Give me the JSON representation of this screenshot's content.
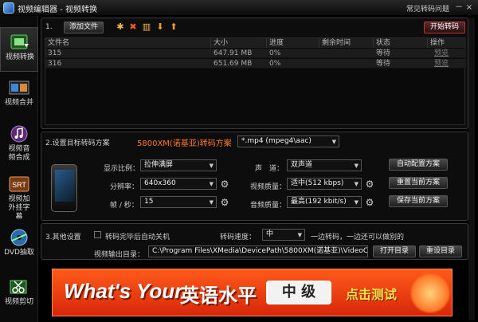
{
  "window": {
    "title": "视频编辑器 - 视频转换",
    "help_link": "常见转码问题",
    "minimize": "－",
    "close": "×"
  },
  "sidebar": {
    "items": [
      {
        "label": "视频转换",
        "icon": "film-convert-icon"
      },
      {
        "label": "视频合并",
        "icon": "film-merge-icon"
      },
      {
        "label": "视频音频合成",
        "icon": "music-note-icon"
      },
      {
        "label": "视频加外挂字幕",
        "icon": "subtitle-icon"
      },
      {
        "label": "DVD抽取",
        "icon": "dvd-disc-icon"
      },
      {
        "label": "视频剪切",
        "icon": "scissors-icon"
      }
    ]
  },
  "files": {
    "section_num": "1.",
    "add_button": "添加文件",
    "start_button": "开始转码",
    "toolbar_icons": [
      "settings-icon",
      "delete-icon",
      "trash-icon",
      "move-down-icon",
      "move-up-icon"
    ],
    "columns": [
      "文件名",
      "大小",
      "进度",
      "剩余时间",
      "状态",
      "操作"
    ],
    "rows": [
      {
        "name": "315",
        "size": "647.91 MB",
        "progress": "0%",
        "remaining": "",
        "status": "等待",
        "action": "预览"
      },
      {
        "name": "316",
        "size": "651.69 MB",
        "progress": "0%",
        "remaining": "",
        "status": "等待",
        "action": "预览"
      }
    ]
  },
  "settings": {
    "section_title": "2.设置目标转码方案",
    "device_name": "5800XM(诺基亚)转码方案",
    "format": "*.mp4 (mpeg4\\aac)",
    "aspect_label": "显示比例：",
    "aspect_value": "拉伸满屏",
    "resolution_label": "分辨率：",
    "resolution_value": "640x360",
    "fps_label": "帧 / 秒：",
    "fps_value": "15",
    "channel_label": "声　道：",
    "channel_value": "双声道",
    "video_quality_label": "视频质量：",
    "video_quality_value": "适中(512 kbps)",
    "audio_quality_label": "音频质量：",
    "audio_quality_value": "最高(192 kbit/s)",
    "auto_config_button": "自动配置方案",
    "reset_button": "重置当前方案",
    "save_button": "保存当前方案"
  },
  "other": {
    "section_title": "3.其他设置",
    "shutdown_label": "转码完毕后自动关机",
    "speed_label": "转码速度：",
    "speed_value": "中",
    "speed_hint": "一边转码，一边还可以做别的",
    "output_label": "视频输出目录：",
    "output_path": "C:\\Program Files\\XMedia\\DevicePath\\5800XM(诺基亚)\\VideoCac",
    "open_dir_button": "打开目录",
    "reset_dir_button": "重设目录"
  },
  "banner": {
    "text_en": "What's Your",
    "text_cn": "英语水平",
    "level": "中 级",
    "cta": "点击测试"
  },
  "colors": {
    "accent_red": "#ff5a1a",
    "device_orange": "#ff7a2a"
  }
}
